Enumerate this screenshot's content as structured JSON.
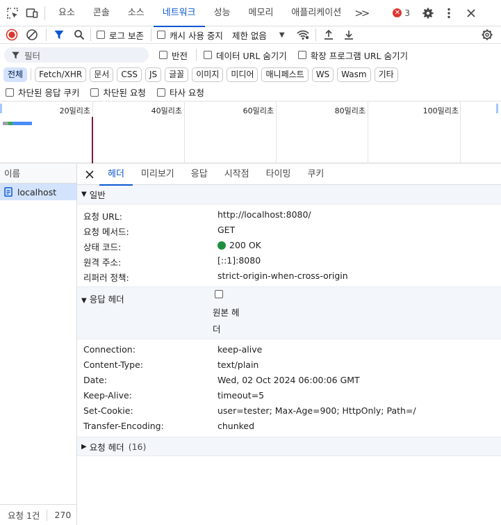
{
  "tabbar": {
    "tabs": [
      "요소",
      "콘솔",
      "소스",
      "네트워크",
      "성능",
      "메모리",
      "애플리케이션"
    ],
    "active_tab": "네트워크",
    "more": ">>",
    "error_count": "3",
    "error_color": "#dc362e",
    "accent_color": "#0b57d0"
  },
  "toolbar": {
    "preserve_log": "로그 보존",
    "disable_cache": "캐시 사용 중지",
    "throttle": "제한 없음"
  },
  "filter": {
    "placeholder": "필터",
    "invert": "반전",
    "hide_data_urls": "데이터 URL 숨기기",
    "hide_ext_urls": "확장 프로그램 URL 숨기기"
  },
  "chips": [
    "전체",
    "Fetch/XHR",
    "문서",
    "CSS",
    "JS",
    "글꼴",
    "이미지",
    "미디어",
    "매니페스트",
    "WS",
    "Wasm",
    "기타"
  ],
  "blocked": {
    "blocked_cookies": "차단된 응답 쿠키",
    "blocked_requests": "차단된 요청",
    "third_party": "타사 요청"
  },
  "overview": {
    "ticks": [
      "20밀리초",
      "40밀리초",
      "60밀리초",
      "80밀리초",
      "100밀리초"
    ]
  },
  "namecol": {
    "header": "이름",
    "rows": [
      "localhost"
    ],
    "footer_requests": "요청 1건",
    "footer_size": "270"
  },
  "detail": {
    "tabs": [
      "헤더",
      "미리보기",
      "응답",
      "시작점",
      "타이밍",
      "쿠키"
    ],
    "active_tab": "헤더",
    "general": {
      "title": "일반",
      "rows": [
        {
          "k": "요청 URL:",
          "v": "http://localhost:8080/"
        },
        {
          "k": "요청 메서드:",
          "v": "GET"
        },
        {
          "k": "상태 코드:",
          "v": "200 OK"
        },
        {
          "k": "원격 주소:",
          "v": "[::1]:8080"
        },
        {
          "k": "리퍼러 정책:",
          "v": "strict-origin-when-cross-origin"
        }
      ]
    },
    "response": {
      "title": "응답 헤더",
      "raw_label_1": "원본 헤",
      "raw_label_2": "더",
      "rows": [
        {
          "k": "Connection:",
          "v": "keep-alive"
        },
        {
          "k": "Content-Type:",
          "v": "text/plain"
        },
        {
          "k": "Date:",
          "v": "Wed, 02 Oct 2024 06:00:06 GMT"
        },
        {
          "k": "Keep-Alive:",
          "v": "timeout=5"
        },
        {
          "k": "Set-Cookie:",
          "v": "user=tester; Max-Age=900; HttpOnly; Path=/"
        },
        {
          "k": "Transfer-Encoding:",
          "v": "chunked"
        }
      ]
    },
    "request": {
      "title": "요청 헤더",
      "count": "(16)"
    }
  }
}
